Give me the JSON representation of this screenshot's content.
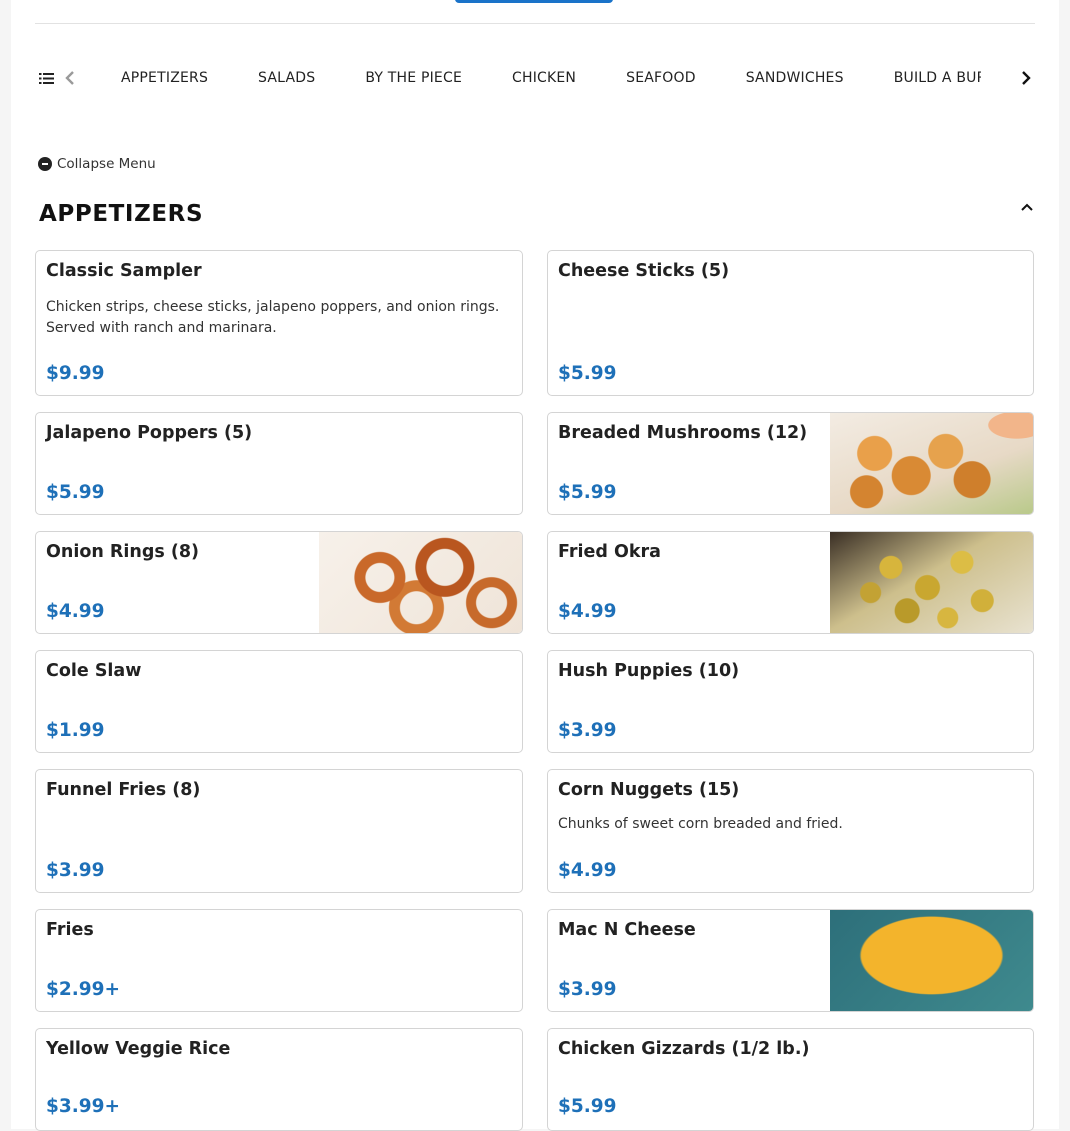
{
  "nav": {
    "categories": [
      "APPETIZERS",
      "SALADS",
      "BY THE PIECE",
      "CHICKEN",
      "SEAFOOD",
      "SANDWICHES",
      "BUILD A BURGER"
    ]
  },
  "collapse_label": "Collapse Menu",
  "section": {
    "title": "APPETIZERS"
  },
  "items": [
    {
      "name": "Classic Sampler",
      "description": "Chicken strips, cheese sticks, jalapeno poppers, and onion rings. Served with ranch and marinara.",
      "price": "$9.99"
    },
    {
      "name": "Cheese Sticks (5)",
      "description": "",
      "price": "$5.99"
    },
    {
      "name": "Jalapeno Poppers (5)",
      "description": "",
      "price": "$5.99"
    },
    {
      "name": "Breaded Mushrooms (12)",
      "description": "",
      "price": "$5.99",
      "image": "breaded-mushrooms-photo"
    },
    {
      "name": "Onion Rings (8)",
      "description": "",
      "price": "$4.99",
      "image": "onion-rings-photo"
    },
    {
      "name": "Fried Okra",
      "description": "",
      "price": "$4.99",
      "image": "fried-okra-photo"
    },
    {
      "name": "Cole Slaw",
      "description": "",
      "price": "$1.99"
    },
    {
      "name": "Hush Puppies (10)",
      "description": "",
      "price": "$3.99"
    },
    {
      "name": "Funnel Fries (8)",
      "description": "",
      "price": "$3.99"
    },
    {
      "name": "Corn Nuggets (15)",
      "description": "Chunks of sweet corn breaded and fried.",
      "price": "$4.99"
    },
    {
      "name": "Fries",
      "description": "",
      "price": "$2.99+"
    },
    {
      "name": "Mac N Cheese",
      "description": "",
      "price": "$3.99",
      "image": "mac-n-cheese-photo"
    },
    {
      "name": "Yellow Veggie Rice",
      "description": "",
      "price": "$3.99+"
    },
    {
      "name": "Chicken Gizzards (1/2 lb.)",
      "description": "",
      "price": "$5.99"
    }
  ],
  "colors": {
    "price": "#1e70b8",
    "primary_button": "#1a73c9"
  },
  "icons": [
    "list-icon",
    "chevron-left-icon",
    "chevron-right-icon",
    "minus-circle-icon",
    "chevron-up-icon"
  ]
}
